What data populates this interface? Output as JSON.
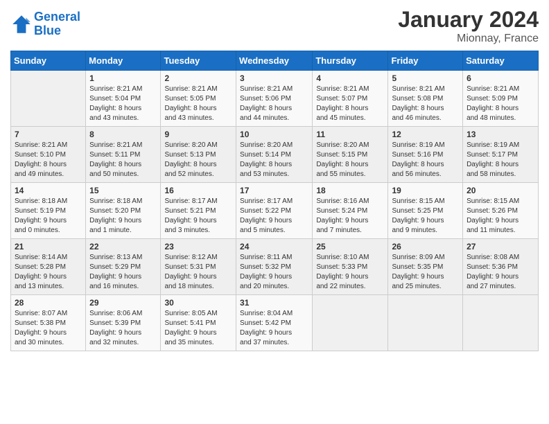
{
  "logo": {
    "line1": "General",
    "line2": "Blue"
  },
  "title": "January 2024",
  "location": "Mionnay, France",
  "days_of_week": [
    "Sunday",
    "Monday",
    "Tuesday",
    "Wednesday",
    "Thursday",
    "Friday",
    "Saturday"
  ],
  "weeks": [
    [
      {
        "day": "",
        "info": ""
      },
      {
        "day": "1",
        "info": "Sunrise: 8:21 AM\nSunset: 5:04 PM\nDaylight: 8 hours\nand 43 minutes."
      },
      {
        "day": "2",
        "info": "Sunrise: 8:21 AM\nSunset: 5:05 PM\nDaylight: 8 hours\nand 43 minutes."
      },
      {
        "day": "3",
        "info": "Sunrise: 8:21 AM\nSunset: 5:06 PM\nDaylight: 8 hours\nand 44 minutes."
      },
      {
        "day": "4",
        "info": "Sunrise: 8:21 AM\nSunset: 5:07 PM\nDaylight: 8 hours\nand 45 minutes."
      },
      {
        "day": "5",
        "info": "Sunrise: 8:21 AM\nSunset: 5:08 PM\nDaylight: 8 hours\nand 46 minutes."
      },
      {
        "day": "6",
        "info": "Sunrise: 8:21 AM\nSunset: 5:09 PM\nDaylight: 8 hours\nand 48 minutes."
      }
    ],
    [
      {
        "day": "7",
        "info": "Sunrise: 8:21 AM\nSunset: 5:10 PM\nDaylight: 8 hours\nand 49 minutes."
      },
      {
        "day": "8",
        "info": "Sunrise: 8:21 AM\nSunset: 5:11 PM\nDaylight: 8 hours\nand 50 minutes."
      },
      {
        "day": "9",
        "info": "Sunrise: 8:20 AM\nSunset: 5:13 PM\nDaylight: 8 hours\nand 52 minutes."
      },
      {
        "day": "10",
        "info": "Sunrise: 8:20 AM\nSunset: 5:14 PM\nDaylight: 8 hours\nand 53 minutes."
      },
      {
        "day": "11",
        "info": "Sunrise: 8:20 AM\nSunset: 5:15 PM\nDaylight: 8 hours\nand 55 minutes."
      },
      {
        "day": "12",
        "info": "Sunrise: 8:19 AM\nSunset: 5:16 PM\nDaylight: 8 hours\nand 56 minutes."
      },
      {
        "day": "13",
        "info": "Sunrise: 8:19 AM\nSunset: 5:17 PM\nDaylight: 8 hours\nand 58 minutes."
      }
    ],
    [
      {
        "day": "14",
        "info": "Sunrise: 8:18 AM\nSunset: 5:19 PM\nDaylight: 9 hours\nand 0 minutes."
      },
      {
        "day": "15",
        "info": "Sunrise: 8:18 AM\nSunset: 5:20 PM\nDaylight: 9 hours\nand 1 minute."
      },
      {
        "day": "16",
        "info": "Sunrise: 8:17 AM\nSunset: 5:21 PM\nDaylight: 9 hours\nand 3 minutes."
      },
      {
        "day": "17",
        "info": "Sunrise: 8:17 AM\nSunset: 5:22 PM\nDaylight: 9 hours\nand 5 minutes."
      },
      {
        "day": "18",
        "info": "Sunrise: 8:16 AM\nSunset: 5:24 PM\nDaylight: 9 hours\nand 7 minutes."
      },
      {
        "day": "19",
        "info": "Sunrise: 8:15 AM\nSunset: 5:25 PM\nDaylight: 9 hours\nand 9 minutes."
      },
      {
        "day": "20",
        "info": "Sunrise: 8:15 AM\nSunset: 5:26 PM\nDaylight: 9 hours\nand 11 minutes."
      }
    ],
    [
      {
        "day": "21",
        "info": "Sunrise: 8:14 AM\nSunset: 5:28 PM\nDaylight: 9 hours\nand 13 minutes."
      },
      {
        "day": "22",
        "info": "Sunrise: 8:13 AM\nSunset: 5:29 PM\nDaylight: 9 hours\nand 16 minutes."
      },
      {
        "day": "23",
        "info": "Sunrise: 8:12 AM\nSunset: 5:31 PM\nDaylight: 9 hours\nand 18 minutes."
      },
      {
        "day": "24",
        "info": "Sunrise: 8:11 AM\nSunset: 5:32 PM\nDaylight: 9 hours\nand 20 minutes."
      },
      {
        "day": "25",
        "info": "Sunrise: 8:10 AM\nSunset: 5:33 PM\nDaylight: 9 hours\nand 22 minutes."
      },
      {
        "day": "26",
        "info": "Sunrise: 8:09 AM\nSunset: 5:35 PM\nDaylight: 9 hours\nand 25 minutes."
      },
      {
        "day": "27",
        "info": "Sunrise: 8:08 AM\nSunset: 5:36 PM\nDaylight: 9 hours\nand 27 minutes."
      }
    ],
    [
      {
        "day": "28",
        "info": "Sunrise: 8:07 AM\nSunset: 5:38 PM\nDaylight: 9 hours\nand 30 minutes."
      },
      {
        "day": "29",
        "info": "Sunrise: 8:06 AM\nSunset: 5:39 PM\nDaylight: 9 hours\nand 32 minutes."
      },
      {
        "day": "30",
        "info": "Sunrise: 8:05 AM\nSunset: 5:41 PM\nDaylight: 9 hours\nand 35 minutes."
      },
      {
        "day": "31",
        "info": "Sunrise: 8:04 AM\nSunset: 5:42 PM\nDaylight: 9 hours\nand 37 minutes."
      },
      {
        "day": "",
        "info": ""
      },
      {
        "day": "",
        "info": ""
      },
      {
        "day": "",
        "info": ""
      }
    ]
  ]
}
